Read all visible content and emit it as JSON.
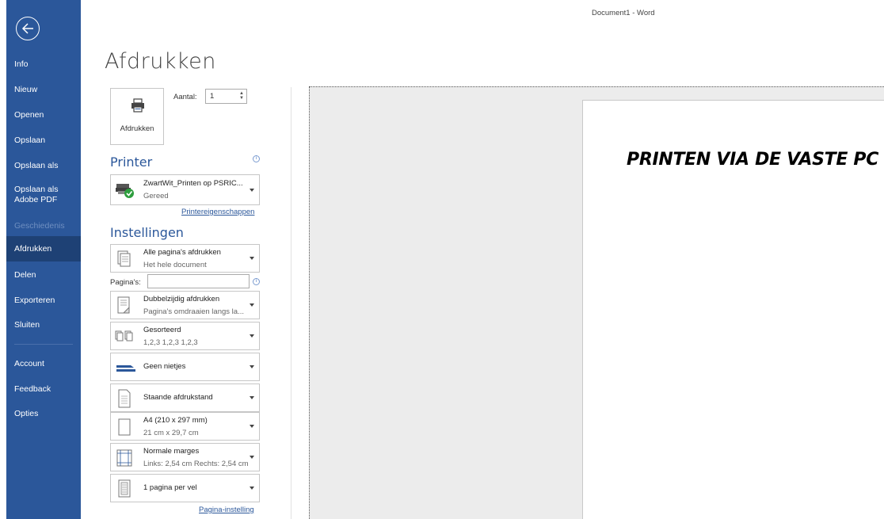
{
  "window": {
    "title": "Document1 - Word"
  },
  "sidebar": {
    "items": [
      {
        "label": "Info"
      },
      {
        "label": "Nieuw"
      },
      {
        "label": "Openen"
      },
      {
        "label": "Opslaan"
      },
      {
        "label": "Opslaan als"
      },
      {
        "label": "Opslaan als Adobe PDF"
      },
      {
        "label": "Geschiedenis",
        "disabled": true
      },
      {
        "label": "Afdrukken",
        "active": true
      },
      {
        "label": "Delen"
      },
      {
        "label": "Exporteren"
      },
      {
        "label": "Sluiten"
      },
      {
        "label": "Account"
      },
      {
        "label": "Feedback"
      },
      {
        "label": "Opties"
      }
    ]
  },
  "main": {
    "title": "Afdrukken",
    "print_button_label": "Afdrukken",
    "copies": {
      "label": "Aantal:",
      "value": "1"
    },
    "printer": {
      "heading": "Printer",
      "name": "ZwartWit_Printen op PSRIC...",
      "status": "Gereed",
      "properties_link": "Printereigenschappen"
    },
    "settings": {
      "heading": "Instellingen",
      "pages_label": "Pagina's:",
      "pages_value": "",
      "items": [
        {
          "title": "Alle pagina's afdrukken",
          "subtitle": "Het hele document",
          "icon": "pages-icon"
        },
        {
          "title": "Dubbelzijdig afdrukken",
          "subtitle": "Pagina's omdraaien langs la...",
          "icon": "duplex-icon"
        },
        {
          "title": "Gesorteerd",
          "subtitle": "1,2,3   1,2,3   1,2,3",
          "icon": "collated-icon"
        },
        {
          "title": "Geen nietjes",
          "subtitle": "",
          "icon": "stapler-icon"
        },
        {
          "title": "Staande afdrukstand",
          "subtitle": "",
          "icon": "portrait-icon"
        },
        {
          "title": "A4 (210 x 297 mm)",
          "subtitle": "21 cm x 29,7 cm",
          "icon": "paper-size-icon"
        },
        {
          "title": "Normale marges",
          "subtitle": "Links: 2,54 cm Rechts: 2,54 cm",
          "icon": "margins-icon"
        },
        {
          "title": "1 pagina per vel",
          "subtitle": "",
          "icon": "pages-per-sheet-icon"
        }
      ],
      "page_setup_link": "Pagina-instelling"
    }
  },
  "preview": {
    "text": "PRINTEN VIA DE VASTE PC"
  },
  "colors": {
    "sidebar": "#2b579a",
    "sidebar_active": "#1e4175",
    "accent": "#2b579a"
  }
}
